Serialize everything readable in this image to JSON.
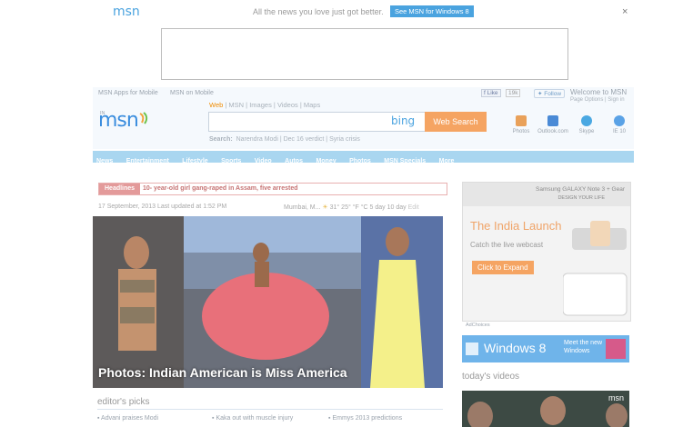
{
  "promo": {
    "logo": "msn",
    "text": "All the news you love just got better.",
    "button": "See MSN for Windows 8",
    "close": "×"
  },
  "toplinks": [
    "MSN Apps for Mobile",
    "MSN on Mobile"
  ],
  "social": {
    "like": "Like",
    "count": "19k",
    "follow": "Follow"
  },
  "welcome": "Welcome to MSN",
  "page_options": "Page Options | Sign in",
  "logo": {
    "region": "IN",
    "text": "msn"
  },
  "search": {
    "tabs": [
      "Web",
      "MSN",
      "Images",
      "Videos",
      "Maps"
    ],
    "active_tab": "Web",
    "bing": "bing",
    "button": "Web Search",
    "trending_label": "Search:",
    "trending": [
      "Narendra Modi",
      "Dec 16 verdict",
      "Syria crisis"
    ]
  },
  "utilities": [
    {
      "label": "Photos",
      "color": "#e9a15a"
    },
    {
      "label": "Outlook.com",
      "color": "#4a8ad6"
    },
    {
      "label": "Skype",
      "color": "#4aa8e2"
    },
    {
      "label": "IE 10",
      "color": "#5aa2e6"
    }
  ],
  "nav": [
    "News",
    "Entertainment",
    "Lifestyle",
    "Sports",
    "Video",
    "Autos",
    "Money",
    "Photos",
    "MSN Specials",
    "More"
  ],
  "headlines": {
    "label": "Headlines",
    "text": "10- year-old girl gang-raped in Assam, five arrested"
  },
  "dateline": "17 September, 2013  Last updated at 1:52 PM",
  "weather": {
    "city": "Mumbai, M...",
    "temp": "31° 25°",
    "units": "°F °C",
    "forecast": "5 day",
    "forecast2": "10 day",
    "edit": "Edit"
  },
  "hero": {
    "caption": "Photos: Indian American is Miss America"
  },
  "editors_picks": {
    "title": "editor's picks",
    "items": [
      "Advani praises Modi",
      "Kaka out with muscle injury",
      "Emmys 2013 predictions"
    ]
  },
  "samsung_ad": {
    "brand": "Samsung GALAXY Note 3 + Gear",
    "tagline": "DESIGN YOUR LIFE",
    "headline": "The India Launch",
    "sub": "Catch the live webcast",
    "button": "Click to Expand"
  },
  "adchoices": "AdChoices",
  "win8_ad": {
    "title": "Windows 8",
    "sub": "Meet the new Windows"
  },
  "videos": {
    "title": "today's videos",
    "logo": "msn"
  }
}
